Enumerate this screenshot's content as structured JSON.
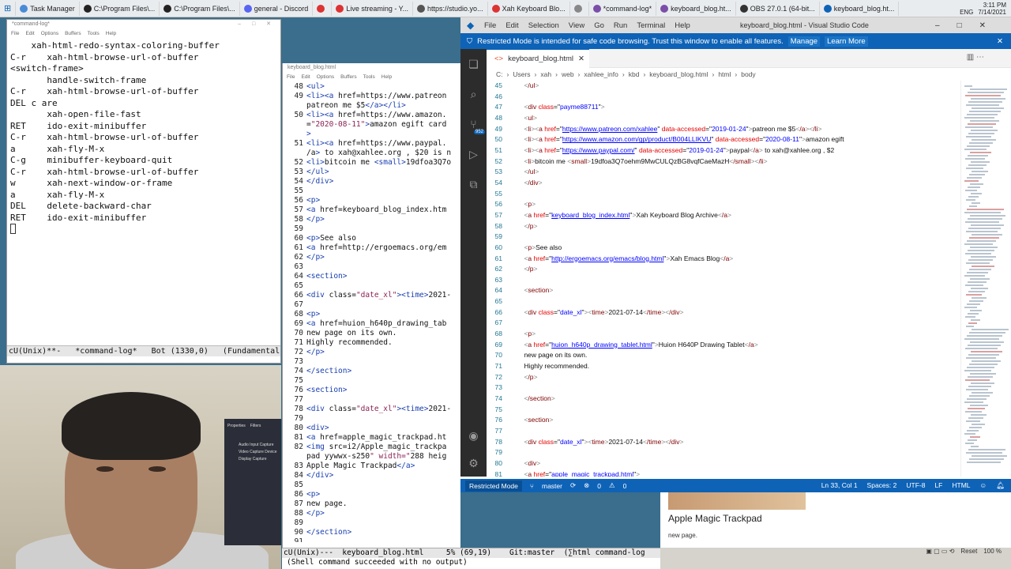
{
  "taskbar": {
    "items": [
      {
        "label": "Task Manager",
        "color": "#4a8bd6"
      },
      {
        "label": "C:\\Program Files\\...",
        "color": "#222"
      },
      {
        "label": "C:\\Program Files\\...",
        "color": "#222"
      },
      {
        "label": "general - Discord",
        "color": "#5865f2"
      },
      {
        "label": "",
        "color": "#d33"
      },
      {
        "label": "Live streaming - Y...",
        "color": "#d33"
      },
      {
        "label": "https://studio.yo...",
        "color": "#555"
      },
      {
        "label": "Xah Keyboard Blo...",
        "color": "#d33"
      },
      {
        "label": "",
        "color": "#888"
      },
      {
        "label": "*command-log*",
        "color": "#7b4ea8"
      },
      {
        "label": "keyboard_blog.ht...",
        "color": "#7b4ea8"
      },
      {
        "label": "OBS 27.0.1 (64-bit...",
        "color": "#333"
      },
      {
        "label": "keyboard_blog.ht...",
        "color": "#0e63b7"
      }
    ],
    "clock_time": "3:11 PM",
    "clock_date": "7/14/2021",
    "lang": "ENG"
  },
  "emacs_log": {
    "title": "*command-log*",
    "menu": [
      "File",
      "Edit",
      "Options",
      "Buffers",
      "Tools",
      "Help"
    ],
    "lines": [
      "    xah-html-redo-syntax-coloring-buffer",
      "C-r    xah-html-browse-url-of-buffer",
      "<switch-frame>",
      "       handle-switch-frame",
      "C-r    xah-html-browse-url-of-buffer",
      "DEL c are",
      "       xah-open-file-fast",
      "RET    ido-exit-minibuffer",
      "C-r    xah-html-browse-url-of-buffer",
      "a      xah-fly-M-x",
      "C-g    minibuffer-keyboard-quit",
      "C-r    xah-html-browse-url-of-buffer",
      "w      xah-next-window-or-frame",
      "a      xah-fly-M-x",
      "DEL    delete-backward-char",
      "RET    ido-exit-minibuffer"
    ],
    "modeline": "cU(Unix)**-   *command-log*   Bot (1330,0)   (Fundamental"
  },
  "emacs_html": {
    "title": "keyboard_blog.html",
    "menu": [
      "File",
      "Edit",
      "Options",
      "Buffers",
      "Tools",
      "Help"
    ],
    "lines": [
      {
        "n": "48",
        "c": "<ul>"
      },
      {
        "n": "49",
        "c": "<li><a href=\"https://www.patreon"
      },
      {
        "n": "",
        "c": "patreon me $5</a></li>"
      },
      {
        "n": "50",
        "c": "<li><a href=\"https://www.amazon."
      },
      {
        "n": "",
        "c": "=\"2020-08-11\">amazon egift card<"
      },
      {
        "n": "",
        "c": ">"
      },
      {
        "n": "51",
        "c": "<li><a href=\"https://www.paypal."
      },
      {
        "n": "",
        "c": "/a> to xah@xahlee.org , $20 is n"
      },
      {
        "n": "52",
        "c": "<li>bitcoin me <small>19dfoa3Q7o"
      },
      {
        "n": "53",
        "c": "</ul>"
      },
      {
        "n": "54",
        "c": "</div>"
      },
      {
        "n": "55",
        "c": ""
      },
      {
        "n": "56",
        "c": "<p>"
      },
      {
        "n": "57",
        "c": "<a href=\"keyboard_blog_index.htm"
      },
      {
        "n": "58",
        "c": "</p>"
      },
      {
        "n": "59",
        "c": ""
      },
      {
        "n": "60",
        "c": "<p>See also"
      },
      {
        "n": "61",
        "c": "<a href=\"http://ergoemacs.org/em"
      },
      {
        "n": "62",
        "c": "</p>"
      },
      {
        "n": "63",
        "c": ""
      },
      {
        "n": "64",
        "c": "<section>"
      },
      {
        "n": "65",
        "c": ""
      },
      {
        "n": "66",
        "c": "<div class=\"date_xl\"><time>2021-"
      },
      {
        "n": "67",
        "c": ""
      },
      {
        "n": "68",
        "c": "<p>"
      },
      {
        "n": "69",
        "c": "<a href=\"huion_h640p_drawing_tab"
      },
      {
        "n": "70",
        "c": "new page on its own."
      },
      {
        "n": "71",
        "c": "Highly recommended."
      },
      {
        "n": "72",
        "c": "</p>"
      },
      {
        "n": "73",
        "c": ""
      },
      {
        "n": "74",
        "c": "</section>"
      },
      {
        "n": "75",
        "c": ""
      },
      {
        "n": "76",
        "c": "<section>"
      },
      {
        "n": "77",
        "c": ""
      },
      {
        "n": "78",
        "c": "<div class=\"date_xl\"><time>2021-"
      },
      {
        "n": "79",
        "c": ""
      },
      {
        "n": "80",
        "c": "<div>"
      },
      {
        "n": "81",
        "c": "<a href=\"apple_magic_trackpad.ht"
      },
      {
        "n": "82",
        "c": "<img src=\"i2/Apple_magic_trackpa"
      },
      {
        "n": "",
        "c": "pad yywwx-s250\" width=\"288\" heig"
      },
      {
        "n": "83",
        "c": "Apple Magic Trackpad</a>"
      },
      {
        "n": "84",
        "c": "</div>"
      },
      {
        "n": "85",
        "c": ""
      },
      {
        "n": "86",
        "c": "<p>"
      },
      {
        "n": "87",
        "c": "new page."
      },
      {
        "n": "88",
        "c": "</p>"
      },
      {
        "n": "89",
        "c": ""
      },
      {
        "n": "90",
        "c": "</section>"
      },
      {
        "n": "91",
        "c": ""
      }
    ],
    "modeline": "cU(Unix)---  keyboard_blog.html     5% (69,19)    Git:master  (∑html command-log",
    "echo": "(Shell command succeeded with no output)"
  },
  "obs": {
    "tabs": [
      "Properties",
      "Filters"
    ],
    "sources": [
      "Audio Input Capture",
      "Video Capture Device",
      "Display Capture"
    ]
  },
  "vscode": {
    "menu": [
      "File",
      "Edit",
      "Selection",
      "View",
      "Go",
      "Run",
      "Terminal",
      "Help"
    ],
    "window_title": "keyboard_blog.html - Visual Studio Code",
    "banner": "Restricted Mode is intended for safe code browsing. Trust this window to enable all features.",
    "banner_manage": "Manage",
    "banner_learn": "Learn More",
    "tab": "keyboard_blog.html",
    "breadcrumbs": [
      "C:",
      "Users",
      "xah",
      "web",
      "xahlee_info",
      "kbd",
      "keyboard_blog.html",
      "html",
      "body"
    ],
    "badge": "952",
    "lines": [
      {
        "n": "45",
        "h": "    </ul>"
      },
      {
        "n": "46",
        "h": ""
      },
      {
        "n": "47",
        "h": "    <div class=\"payme88711\">"
      },
      {
        "n": "48",
        "h": "    <ul>"
      },
      {
        "n": "49",
        "h": "    <li><a href=\"https://www.patreon.com/xahlee\" data-accessed=\"2019-01-24\">patreon me $5</a></li>"
      },
      {
        "n": "50",
        "h": "    <li><a href=\"https://www.amazon.com/gp/product/B004LLIKVU\" data-accessed=\"2020-08-11\">amazon egift"
      },
      {
        "n": "51",
        "h": "    <li><a href=\"https://www.paypal.com/\" data-accessed=\"2019-01-24\">paypal</a> to xah@xahlee.org , $2"
      },
      {
        "n": "52",
        "h": "    <li>bitcoin me <small>19dfoa3Q7oehm9MwCULQzBG8vqfCaeMazH</small></li>"
      },
      {
        "n": "53",
        "h": "    </ul>"
      },
      {
        "n": "54",
        "h": "    </div>"
      },
      {
        "n": "55",
        "h": ""
      },
      {
        "n": "56",
        "h": "    <p>"
      },
      {
        "n": "57",
        "h": "    <a href=\"keyboard_blog_index.html\">Xah Keyboard Blog Archive</a>"
      },
      {
        "n": "58",
        "h": "    </p>"
      },
      {
        "n": "59",
        "h": ""
      },
      {
        "n": "60",
        "h": "    <p>See also"
      },
      {
        "n": "61",
        "h": "    <a href=\"http://ergoemacs.org/emacs/blog.html\">Xah Emacs Blog</a>"
      },
      {
        "n": "62",
        "h": "    </p>"
      },
      {
        "n": "63",
        "h": ""
      },
      {
        "n": "64",
        "h": "    <section>"
      },
      {
        "n": "65",
        "h": ""
      },
      {
        "n": "66",
        "h": "    <div class=\"date_xl\"><time>2021-07-14</time></div>"
      },
      {
        "n": "67",
        "h": ""
      },
      {
        "n": "68",
        "h": "    <p>"
      },
      {
        "n": "69",
        "h": "    <a href=\"huion_h640p_drawing_tablet.html\">Huion H640P Drawing Tablet</a>"
      },
      {
        "n": "70",
        "h": "    new page on its own."
      },
      {
        "n": "71",
        "h": "    Highly recommended."
      },
      {
        "n": "72",
        "h": "    </p>"
      },
      {
        "n": "73",
        "h": ""
      },
      {
        "n": "74",
        "h": "    </section>"
      },
      {
        "n": "75",
        "h": ""
      },
      {
        "n": "76",
        "h": "    <section>"
      },
      {
        "n": "77",
        "h": ""
      },
      {
        "n": "78",
        "h": "    <div class=\"date_xl\"><time>2021-07-14</time></div>"
      },
      {
        "n": "79",
        "h": ""
      },
      {
        "n": "80",
        "h": "    <div>"
      },
      {
        "n": "81",
        "h": "    <a href=\"apple_magic_trackpad.html\">"
      }
    ],
    "status": {
      "mode": "Restricted Mode",
      "branch": "master",
      "problems": "0",
      "warnings": "0",
      "position": "Ln 33, Col 1",
      "spaces": "Spaces: 2",
      "encoding": "UTF-8",
      "eol": "LF",
      "language": "HTML"
    }
  },
  "preview": {
    "title": "Apple Magic Trackpad",
    "sub": "new page.",
    "bottom_reset": "Reset",
    "bottom_zoom": "100 %"
  }
}
